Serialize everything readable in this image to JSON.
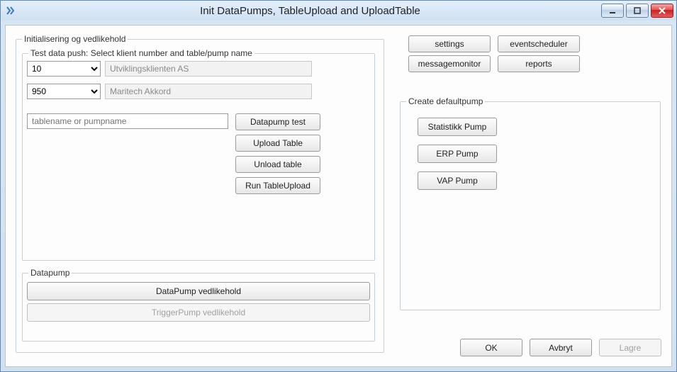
{
  "window": {
    "title": "Init DataPumps, TableUpload and UploadTable"
  },
  "init_group": {
    "legend": "Initialisering og vedlikehold"
  },
  "testdata": {
    "legend": "Test data push: Select klient number and table/pump name",
    "client_number": "10",
    "client_name": "Utviklingsklienten AS",
    "module_number": "950",
    "module_name": "Maritech Akkord",
    "tablename_placeholder": "tablename or pumpname",
    "actions": {
      "datapump_test": "Datapump test",
      "upload_table": "Upload Table",
      "unload_table": "Unload table",
      "run_tableupload": "Run TableUpload"
    }
  },
  "datapump": {
    "legend": "Datapump",
    "vedlikehold": "DataPump vedlikehold",
    "trigger_vedlikehold": "TriggerPump vedlikehold"
  },
  "top_buttons": {
    "settings": "settings",
    "eventscheduler": "eventscheduler",
    "messagemonitor": "messagemonitor",
    "reports": "reports"
  },
  "create_pump": {
    "legend": "Create defaultpump",
    "statistikk": "Statistikk Pump",
    "erp": "ERP Pump",
    "vap": "VAP Pump"
  },
  "dialog": {
    "ok": "OK",
    "cancel": "Avbryt",
    "save": "Lagre"
  }
}
